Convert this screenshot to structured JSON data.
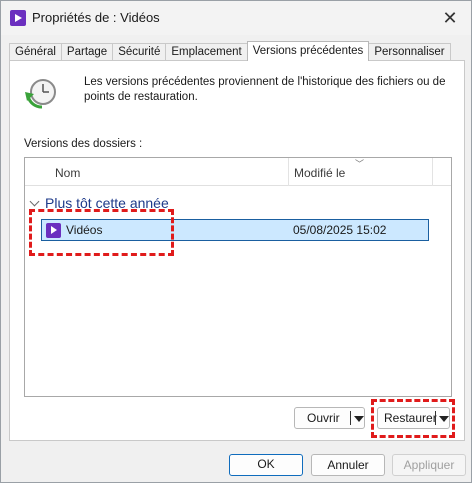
{
  "window": {
    "title": "Propriétés de : Vidéos",
    "close_glyph": "✕"
  },
  "tabs": [
    {
      "label": "Général",
      "active": false
    },
    {
      "label": "Partage",
      "active": false
    },
    {
      "label": "Sécurité",
      "active": false
    },
    {
      "label": "Emplacement",
      "active": false
    },
    {
      "label": "Versions précédentes",
      "active": true
    },
    {
      "label": "Personnaliser",
      "active": false
    }
  ],
  "panel": {
    "icon": "restore-clock-icon",
    "description": "Les versions précédentes proviennent de l'historique des fichiers ou de points de restauration.",
    "versions_label": "Versions des dossiers :",
    "columns": {
      "name": "Nom",
      "modified": "Modifié le"
    },
    "group": "Plus tôt cette année",
    "rows": [
      {
        "icon": "video-folder-icon",
        "name": "Vidéos",
        "modified": "05/08/2025 15:02",
        "selected": true
      }
    ],
    "open_button": "Ouvrir",
    "restore_button": "Restaurer"
  },
  "footer": {
    "ok": "OK",
    "cancel": "Annuler",
    "apply": "Appliquer"
  },
  "colors": {
    "highlight": "#e01b1b",
    "selection": "#cce8ff",
    "group_text": "#1e3a8a",
    "accent": "#0f6cbd"
  }
}
